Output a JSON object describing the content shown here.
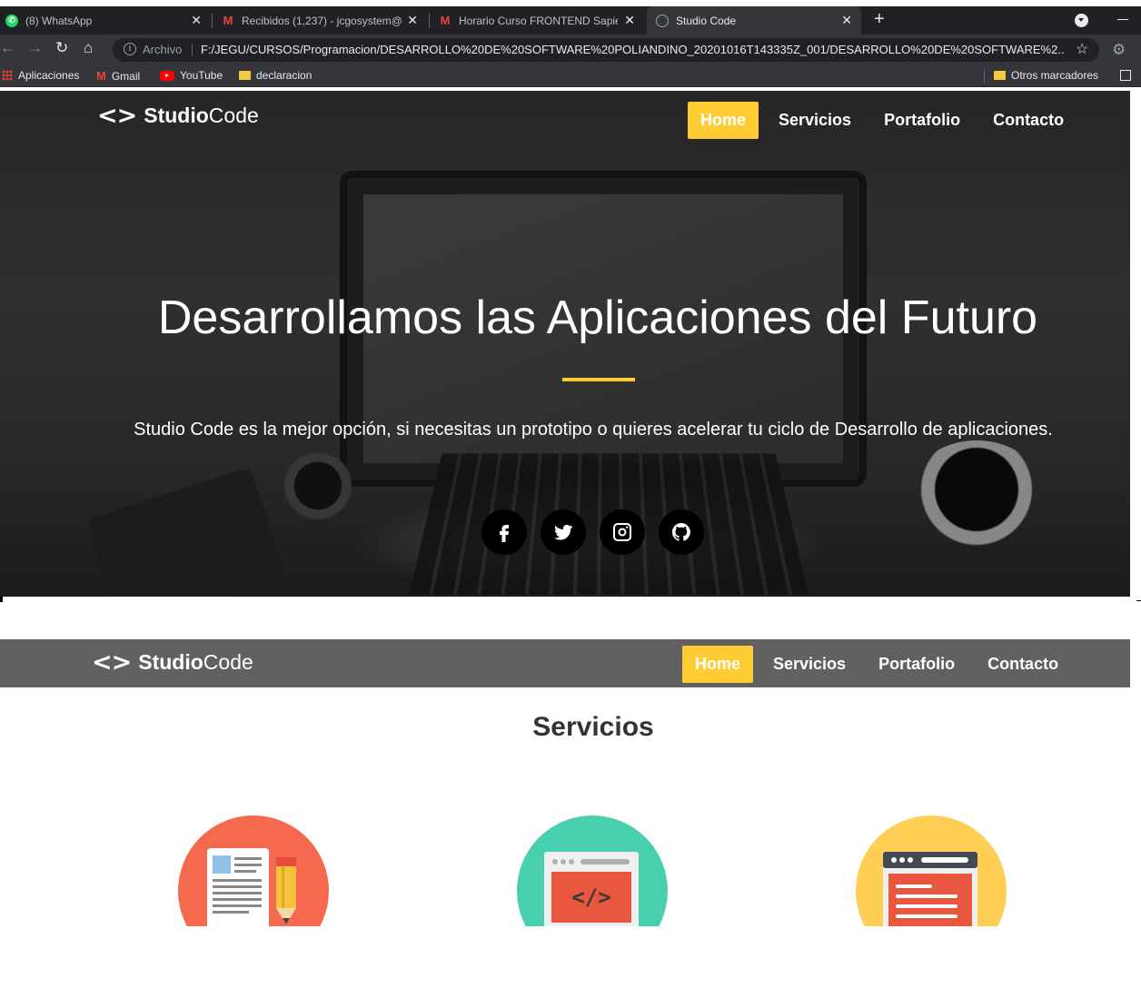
{
  "browser": {
    "tabs": [
      {
        "title": "(8) WhatsApp",
        "icon": "whatsapp-icon",
        "active": false
      },
      {
        "title": "Recibidos (1,237) - jcgosystem@",
        "icon": "gmail-icon",
        "active": false
      },
      {
        "title": "Horario Curso FRONTEND Sapier",
        "icon": "gmail-icon",
        "active": false
      },
      {
        "title": "Studio Code",
        "icon": "globe-icon",
        "active": true
      }
    ],
    "omnibox": {
      "label": "Archivo",
      "url": "F:/JEGU/CURSOS/Programacion/DESARROLLO%20DE%20SOFTWARE%20POLIANDINO_20201016T143335Z_001/DESARROLLO%20DE%20SOFTWARE%2..."
    },
    "bookmarks": [
      "Aplicaciones",
      "Gmail",
      "YouTube",
      "declaracion"
    ],
    "other_bookmarks": "Otros marcadores"
  },
  "site": {
    "logo": {
      "brackets": "<>",
      "bold": "Studio",
      "light": "Code"
    },
    "menu": [
      "Home",
      "Servicios",
      "Portafolio",
      "Contacto"
    ],
    "accent_color": "#ffcc33"
  },
  "hero": {
    "title": "Desarrollamos las Aplicaciones del Futuro",
    "text": "Studio Code es la mejor opción, si necesitas un prototipo o quieres acelerar tu ciclo de Desarrollo de aplicaciones.",
    "socials": [
      "facebook-icon",
      "twitter-icon",
      "instagram-icon",
      "github-icon"
    ]
  },
  "services": {
    "title": "Servicios",
    "items": [
      {
        "icon": "document-pencil-icon",
        "color": "#f56a4e"
      },
      {
        "icon": "code-window-icon",
        "color": "#48cfad"
      },
      {
        "icon": "browser-layout-icon",
        "color": "#ffce54"
      }
    ]
  }
}
